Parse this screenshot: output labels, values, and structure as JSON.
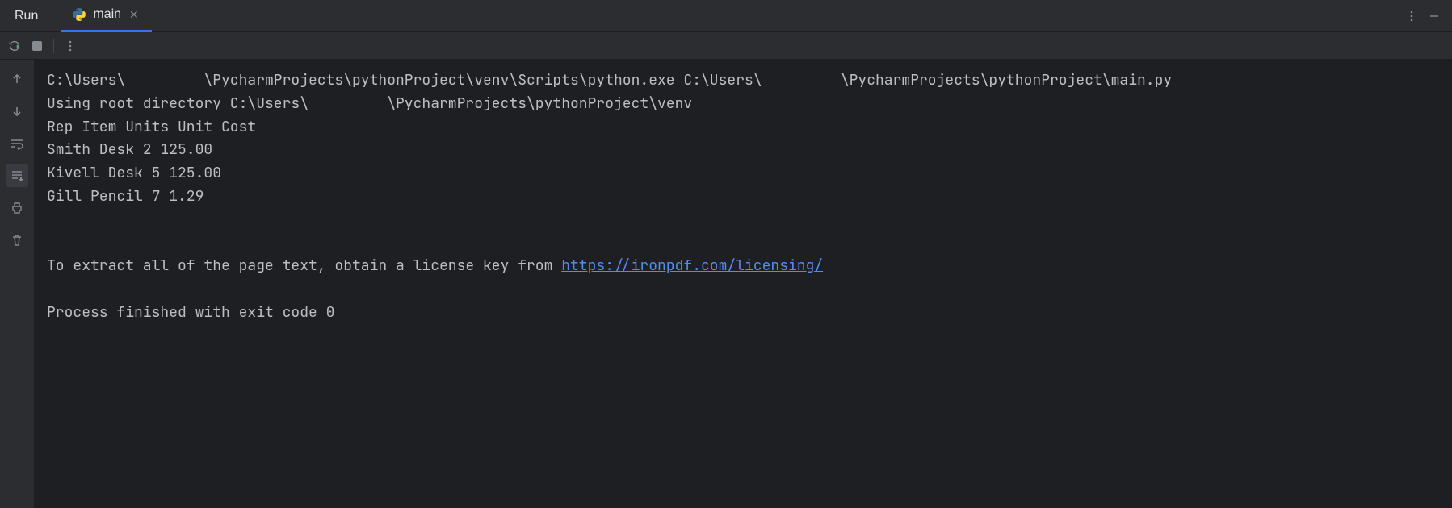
{
  "header": {
    "run_label": "Run",
    "tab_label": "main"
  },
  "console": {
    "line1_a": "C:\\Users\\",
    "line1_b": "\\PycharmProjects\\pythonProject\\venv\\Scripts\\python.exe C:\\Users\\",
    "line1_c": "\\PycharmProjects\\pythonProject\\main.py",
    "line2_a": "Using root directory C:\\Users\\",
    "line2_b": "\\PycharmProjects\\pythonProject\\venv",
    "line3": "Rep Item Units Unit Cost",
    "line4": "Smith Desk 2 125.00",
    "line5": "Kivell Desk 5 125.00",
    "line6": "Gill Pencil 7 1.29",
    "license_prefix": "To extract all of the page text, obtain a license key from ",
    "license_url": "https://ironpdf.com/licensing/",
    "exit_line": "Process finished with exit code 0"
  }
}
